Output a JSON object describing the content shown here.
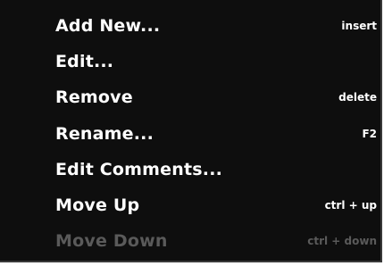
{
  "menu": {
    "items": [
      {
        "label": "Add New...",
        "shortcut": "insert",
        "enabled": true
      },
      {
        "label": "Edit...",
        "shortcut": "",
        "enabled": true
      },
      {
        "label": "Remove",
        "shortcut": "delete",
        "enabled": true
      },
      {
        "label": "Rename...",
        "shortcut": "F2",
        "enabled": true
      },
      {
        "label": "Edit Comments...",
        "shortcut": "",
        "enabled": true
      },
      {
        "label": "Move Up",
        "shortcut": "ctrl + up",
        "enabled": true
      },
      {
        "label": "Move Down",
        "shortcut": "ctrl + down",
        "enabled": false
      }
    ]
  },
  "colors": {
    "background": "#0e0e0e",
    "text": "#ffffff",
    "disabled_text": "#5a5a5a",
    "border": "#3a3a3a"
  }
}
